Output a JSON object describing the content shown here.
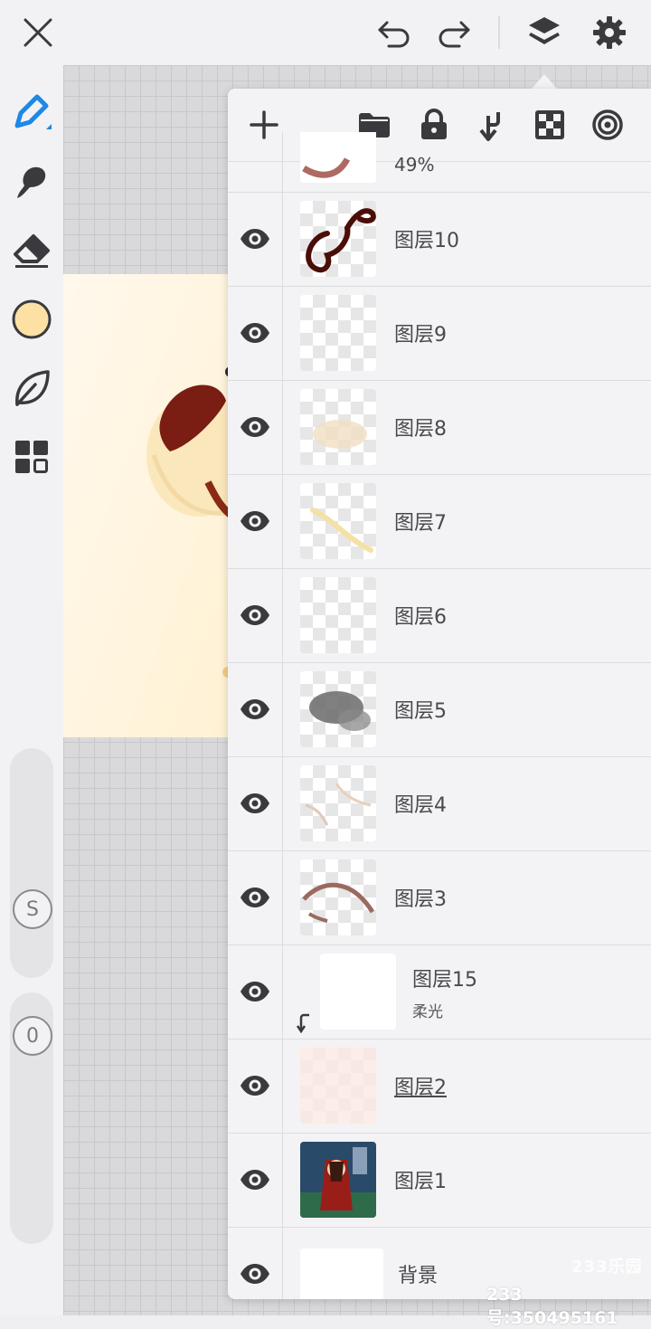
{
  "topbar": {
    "icons": [
      "close-icon",
      "undo-icon",
      "redo-icon",
      "layers-icon",
      "gear-icon"
    ]
  },
  "left_toolbar": {
    "current_color": "#fde1a4",
    "slider_size_label": "S",
    "slider_opacity_label": "0"
  },
  "layer_panel": {
    "toolbar_icons": [
      "add-icon",
      "folder-icon",
      "lock-icon",
      "merge-down-icon",
      "checker-icon",
      "target-icon"
    ],
    "partial_row_opacity": "49%",
    "layers": [
      {
        "name": "图层10",
        "visible": true
      },
      {
        "name": "图层9",
        "visible": true
      },
      {
        "name": "图层8",
        "visible": true
      },
      {
        "name": "图层7",
        "visible": true
      },
      {
        "name": "图层6",
        "visible": true
      },
      {
        "name": "图层5",
        "visible": true
      },
      {
        "name": "图层4",
        "visible": true
      },
      {
        "name": "图层3",
        "visible": true
      },
      {
        "name": "图层15",
        "visible": true,
        "blend": "柔光",
        "clipped": true
      },
      {
        "name": "图层2",
        "visible": true
      },
      {
        "name": "图层1",
        "visible": true
      },
      {
        "name": "背景",
        "visible": true
      }
    ]
  },
  "watermark": {
    "logo": "233乐园",
    "text": "233号:350495161"
  },
  "colors": {
    "accent": "#1e88e5",
    "icon_dark": "#3a3a3e"
  }
}
